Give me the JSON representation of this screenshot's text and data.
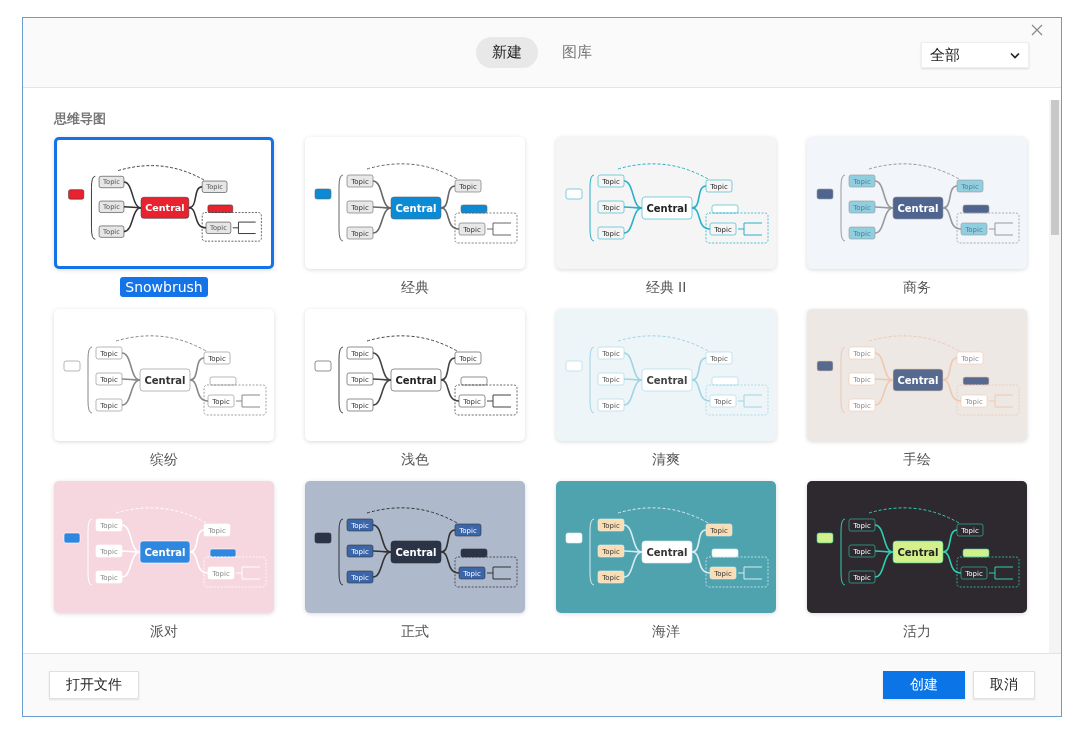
{
  "header": {
    "tabs": [
      {
        "label": "新建",
        "selected": true
      },
      {
        "label": "图库",
        "selected": false
      }
    ],
    "filter": {
      "value": "全部"
    }
  },
  "section_title": "思维导图",
  "templates": [
    {
      "name": "Snowbrush",
      "selected": true,
      "color": "#e8232f",
      "central": "Central",
      "topics": [
        "Topic",
        "Topic",
        "Topic",
        "Topic",
        "Topic"
      ]
    },
    {
      "name": "经典",
      "selected": false,
      "color": "#0b8ad6",
      "central": "Central",
      "topics": [
        "Topic",
        "Topic",
        "Topic",
        "Topic",
        "Topic"
      ]
    },
    {
      "name": "经典 II",
      "selected": false,
      "color": "#ffffff",
      "central": "Central",
      "topics": [
        "Topic",
        "Topic",
        "Topic",
        "Topic",
        "Topic"
      ]
    },
    {
      "name": "商务",
      "selected": false,
      "color": "#4f6590",
      "central": "Central",
      "topics": [
        "Topic",
        "Topic",
        "Topic",
        "Topic",
        "Topic"
      ]
    },
    {
      "name": "缤纷",
      "selected": false,
      "color": "#ffffff",
      "central": "Central",
      "topics": [
        "Topic",
        "Topic",
        "Topic",
        "Topic",
        "Topic"
      ]
    },
    {
      "name": "浅色",
      "selected": false,
      "color": "#ffffff",
      "central": "Central",
      "topics": [
        "Topic",
        "Topic",
        "Topic",
        "Topic",
        "Topic"
      ]
    },
    {
      "name": "清爽",
      "selected": false,
      "color": "#ffffff",
      "central": "Central",
      "topics": [
        "Topic",
        "Topic",
        "Topic",
        "Topic",
        "Topic"
      ]
    },
    {
      "name": "手绘",
      "selected": false,
      "color": "#56698f",
      "central": "Central",
      "topics": [
        "Topic",
        "Topic",
        "Topic",
        "Topic",
        "Topic"
      ]
    },
    {
      "name": "派对",
      "selected": false,
      "color": "#2f87e0",
      "central": "Central",
      "topics": [
        "Topic",
        "Topic",
        "Topic",
        "Topic",
        "Topic"
      ]
    },
    {
      "name": "正式",
      "selected": false,
      "color": "#2a3446",
      "central": "Central",
      "topics": [
        "Topic",
        "Topic",
        "Topic",
        "Topic",
        "Topic"
      ]
    },
    {
      "name": "海洋",
      "selected": false,
      "color": "#ffffff",
      "central": "Central",
      "topics": [
        "Topic",
        "Topic",
        "Topic",
        "Topic",
        "Topic"
      ]
    },
    {
      "name": "活力",
      "selected": false,
      "color": "#d4f08a",
      "central": "Central",
      "topics": [
        "Topic",
        "Topic",
        "Topic",
        "Topic",
        "Topic"
      ]
    }
  ],
  "footer": {
    "open_button": "打开文件",
    "create_button": "创建",
    "cancel_button": "取消"
  }
}
